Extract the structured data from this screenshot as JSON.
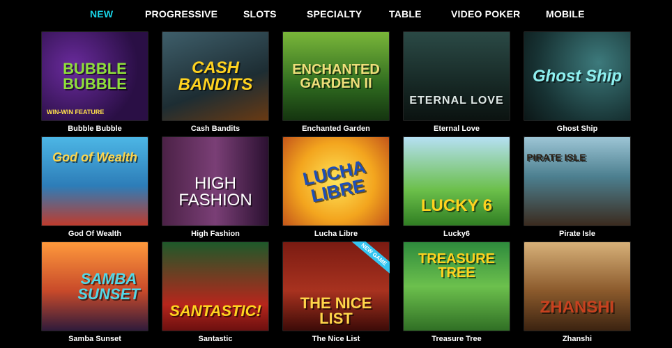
{
  "nav": {
    "items": [
      {
        "label": "NEW",
        "active": true
      },
      {
        "label": "PROGRESSIVE",
        "active": false
      },
      {
        "label": "SLOTS",
        "active": false
      },
      {
        "label": "SPECIALTY",
        "active": false
      },
      {
        "label": "TABLE",
        "active": false
      },
      {
        "label": "VIDEO POKER",
        "active": false
      },
      {
        "label": "MOBILE",
        "active": false
      }
    ],
    "active_color": "#19d5e8"
  },
  "games": [
    {
      "name": "Bubble Bubble",
      "art": "BUBBLE BUBBLE",
      "sub": "WIN-WIN FEATURE",
      "badge": ""
    },
    {
      "name": "Cash Bandits",
      "art": "CASH BANDITS",
      "sub": "",
      "badge": ""
    },
    {
      "name": "Enchanted Garden",
      "art": "ENCHANTED GARDEN II",
      "sub": "",
      "badge": ""
    },
    {
      "name": "Eternal Love",
      "art": "ETERNAL LOVE",
      "sub": "",
      "badge": ""
    },
    {
      "name": "Ghost Ship",
      "art": "Ghost Ship",
      "sub": "",
      "badge": ""
    },
    {
      "name": "God Of Wealth",
      "art": "God of Wealth",
      "sub": "",
      "badge": ""
    },
    {
      "name": "High Fashion",
      "art": "HIGH FASHION",
      "sub": "",
      "badge": ""
    },
    {
      "name": "Lucha Libre",
      "art": "LUCHA LIBRE",
      "sub": "",
      "badge": ""
    },
    {
      "name": "Lucky6",
      "art": "LUCKY 6",
      "sub": "",
      "badge": ""
    },
    {
      "name": "Pirate Isle",
      "art": "PIRATE ISLE",
      "sub": "",
      "badge": ""
    },
    {
      "name": "Samba Sunset",
      "art": "SAMBA SUNSET",
      "sub": "",
      "badge": ""
    },
    {
      "name": "Santastic",
      "art": "SANTASTIC!",
      "sub": "",
      "badge": ""
    },
    {
      "name": "The Nice List",
      "art": "THE NICE LIST",
      "sub": "",
      "badge": "NEW GAME"
    },
    {
      "name": "Treasure Tree",
      "art": "TREASURE TREE",
      "sub": "",
      "badge": ""
    },
    {
      "name": "Zhanshi",
      "art": "ZHANSHI",
      "sub": "",
      "badge": ""
    }
  ]
}
